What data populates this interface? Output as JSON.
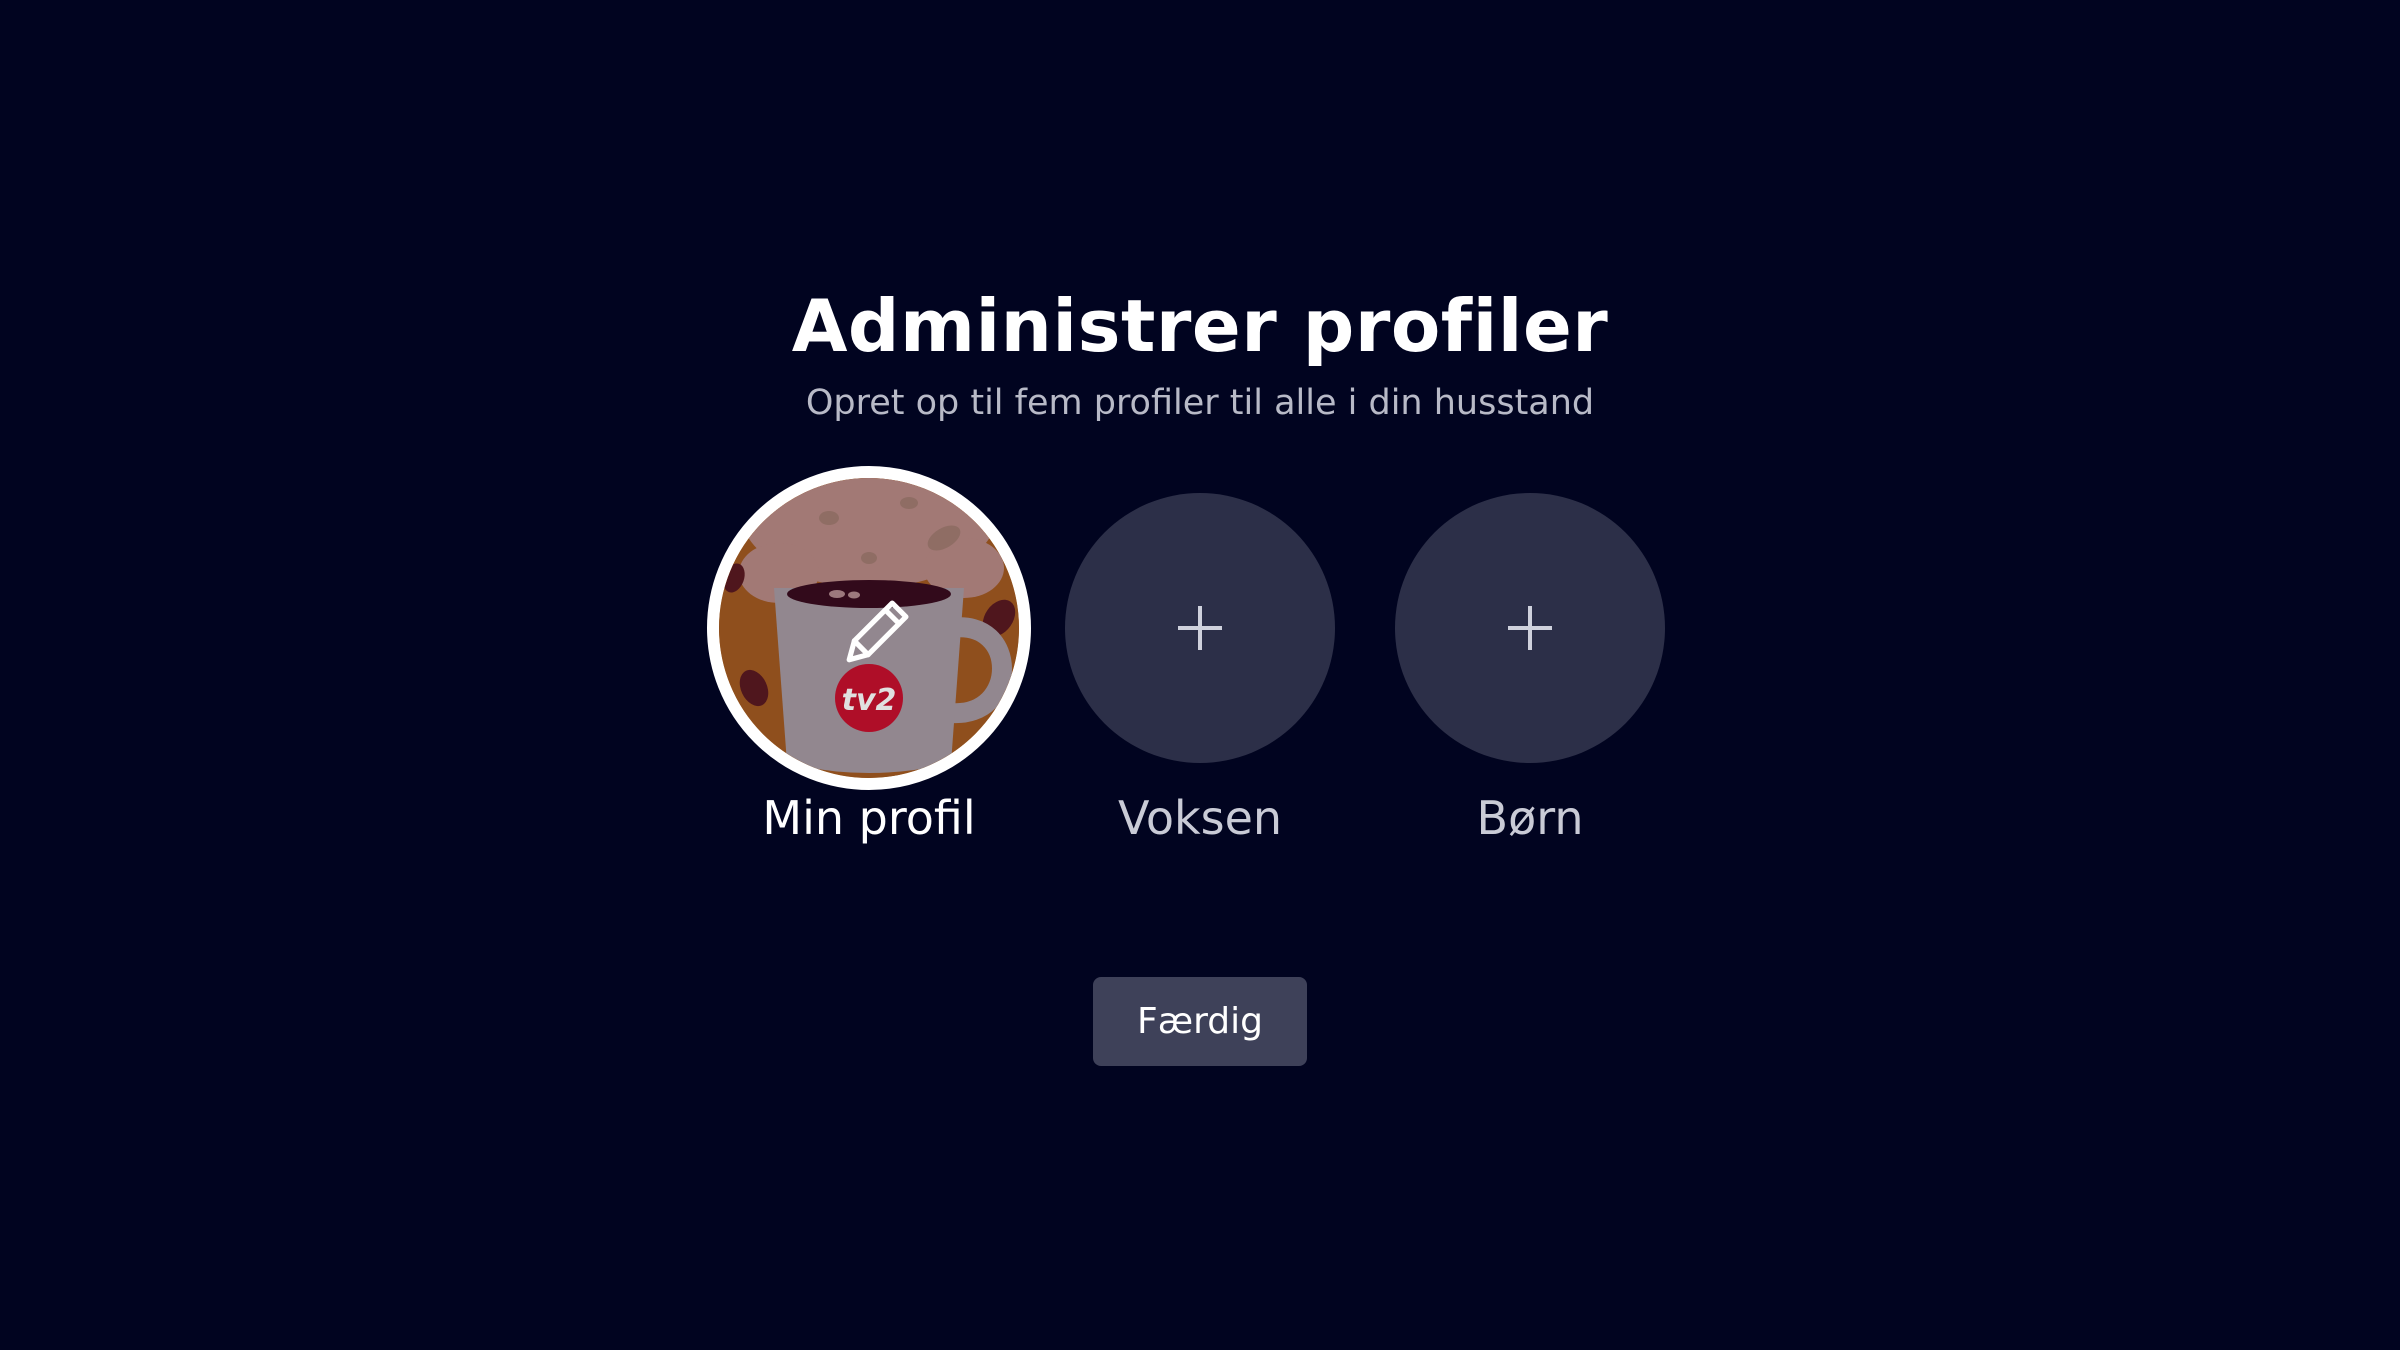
{
  "header": {
    "title": "Administrer profiler",
    "subtitle": "Opret op til fem profiler til alle i din husstand"
  },
  "profiles": [
    {
      "label": "Min profil",
      "selected": true,
      "avatar_icon": "coffee-mug-icon",
      "overlay_icon": "pencil-icon",
      "badge_text": "tv2"
    },
    {
      "label": "Voksen",
      "selected": false,
      "icon": "plus-icon"
    },
    {
      "label": "Børn",
      "selected": false,
      "icon": "plus-icon"
    }
  ],
  "actions": {
    "done_label": "Færdig"
  },
  "colors": {
    "background": "#010420",
    "avatar_empty": "#2c2f48",
    "button": "#3e4159",
    "badge_red": "#c8102e"
  }
}
